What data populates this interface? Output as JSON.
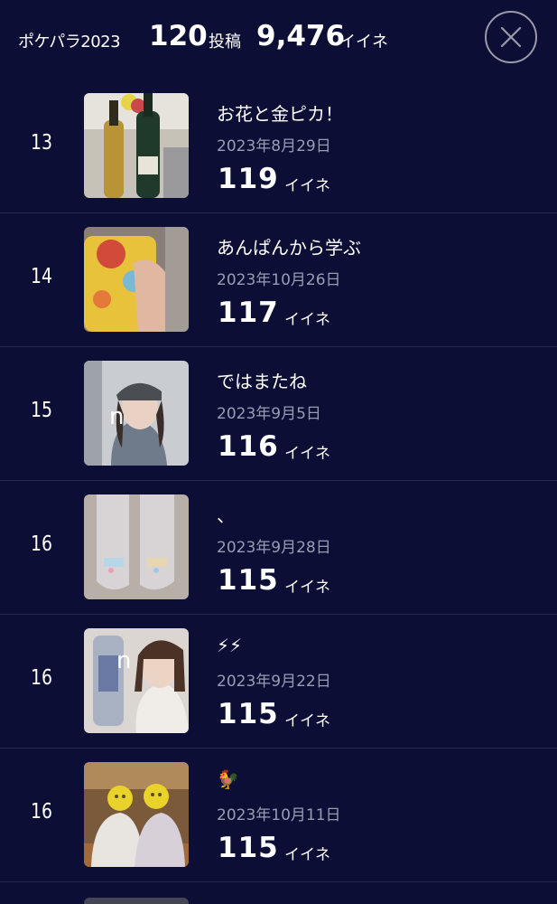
{
  "header": {
    "title": "ポケパラ2023",
    "posts_count": "120",
    "posts_unit": "投稿",
    "likes_total": "9,476",
    "likes_unit": "イイネ",
    "close_icon": "close-icon"
  },
  "rows": [
    {
      "rank": "13",
      "title": "お花と金ピカ！",
      "date": "2023年8月29日",
      "likes": "119",
      "likes_unit": "イイネ"
    },
    {
      "rank": "14",
      "title": "あんぱんから学ぶ",
      "date": "2023年10月26日",
      "likes": "117",
      "likes_unit": "イイネ"
    },
    {
      "rank": "15",
      "title": "ではまたね",
      "date": "2023年9月5日",
      "likes": "116",
      "likes_unit": "イイネ"
    },
    {
      "rank": "16",
      "title": "、",
      "date": "2023年9月28日",
      "likes": "115",
      "likes_unit": "イイネ"
    },
    {
      "rank": "16",
      "title": "⚡⚡",
      "date": "2023年9月22日",
      "likes": "115",
      "likes_unit": "イイネ"
    },
    {
      "rank": "16",
      "title": "🐓",
      "date": "2023年10月11日",
      "likes": "115",
      "likes_unit": "イイネ"
    }
  ],
  "colors": {
    "background": "#0c0e36",
    "text": "#ffffff",
    "date": "#9a9cb2",
    "divider": "#24284e"
  }
}
